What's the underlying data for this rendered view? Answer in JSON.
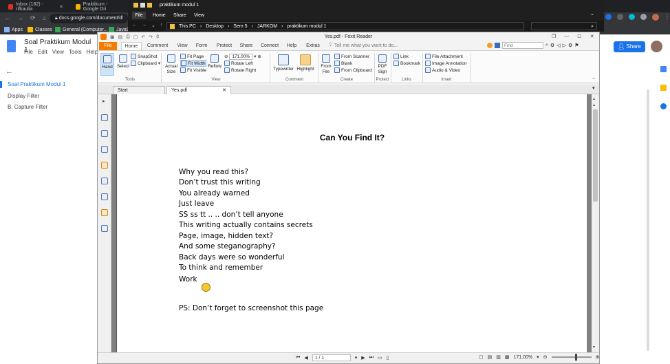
{
  "chrome": {
    "tabs": [
      "Inbox (182) - rifkaulia",
      "Praktikum - Google Dri",
      "praktikum modul 1"
    ],
    "url": "docs.google.com/document/d/",
    "bookmarks": [
      "Apps",
      "Classes",
      "General (Computer...",
      "JavaS"
    ]
  },
  "gdocs": {
    "title": "Soal Praktikum Modul 1",
    "menu": [
      "File",
      "Edit",
      "View",
      "Tools",
      "Help"
    ],
    "outline": [
      "Soal Praktikum Modul 1",
      "Display Filter",
      "B. Capture Filter"
    ],
    "share_label": "Share"
  },
  "explorer": {
    "title": "praktikum modul 1",
    "tabs": [
      "File",
      "Home",
      "Share",
      "View"
    ],
    "path": [
      "This PC",
      "Desktop",
      "Sem 5",
      "JARKOM",
      "praktikum modul 1"
    ]
  },
  "foxit": {
    "window_title": "Yes.pdf - Foxit Reader",
    "find_placeholder": "Find",
    "menu": [
      "File",
      "Home",
      "Comment",
      "View",
      "Form",
      "Protect",
      "Share",
      "Connect",
      "Help",
      "Extras"
    ],
    "tell_me": "Tell me what you want to do...",
    "ribbon": {
      "hand": "Hand",
      "select": "Select",
      "snapshot": "SnapShot",
      "clipboard": "Clipboard",
      "actual_size": "Actual Size",
      "fit_page": "Fit Page",
      "fit_width": "Fit Width",
      "fit_visible": "Fit Visible",
      "reflow": "Reflow",
      "zoom": "171.00%",
      "rotate_left": "Rotate Left",
      "rotate_right": "Rotate Right",
      "typewriter": "Typewriter",
      "highlight": "Highlight",
      "from_file": "From File",
      "from_scanner": "From Scanner",
      "blank": "Blank",
      "from_clipboard": "From Clipboard",
      "pdf_sign": "PDF Sign",
      "link": "Link",
      "bookmark": "Bookmark",
      "file_attachment": "File Attachment",
      "image_annotation": "Image Annotation",
      "audio_video": "Audio & Video",
      "groups": [
        "Tools",
        "View",
        "Comment",
        "Create",
        "Protect",
        "Links",
        "Insert"
      ]
    },
    "doc_tabs": [
      "Start",
      "Yes.pdf"
    ],
    "page": {
      "title": "Can You Find It?",
      "lines": [
        "Why you read this?",
        "Don’t trust this writing",
        "You already warned",
        "Just leave",
        "SS ss tt .. .. don’t tell anyone",
        "This writing actually contains secrets",
        "Page, image, hidden text?",
        "And some steganography?",
        "Back days were so wonderful",
        "To think and remember",
        "Work"
      ],
      "emoji": "😊",
      "ps": "PS: Don’t forget to screenshot this page"
    },
    "status": {
      "page_indicator": "1 / 1",
      "zoom": "171.00%"
    }
  }
}
